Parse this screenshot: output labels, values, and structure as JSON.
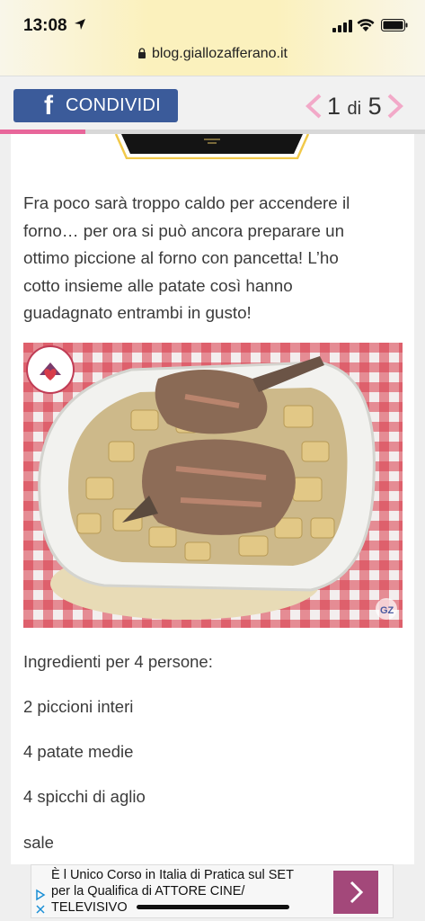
{
  "status_bar": {
    "time": "13:08"
  },
  "url_bar": {
    "domain": "blog.giallozafferano.it"
  },
  "share_bar": {
    "facebook_label": "CONDIVIDI",
    "page_current": "1",
    "page_separator": "di",
    "page_total": "5",
    "progress_fraction": 0.2
  },
  "article": {
    "intro_lines": [
      "Fra poco sarà troppo caldo per accendere il",
      "forno… per ora si può ancora preparare un",
      "ottimo piccione al forno con pancetta! L’ho",
      "cotto insieme alle patate così hanno",
      "guadagnato entrambi in gusto!"
    ],
    "photo_watermark": "GZ",
    "ingredients_title": "Ingredienti per 4 persone:",
    "ingredients": [
      "2 piccioni interi",
      "4 patate medie",
      "4 spicchi di aglio",
      "sale"
    ]
  },
  "ad": {
    "lines": [
      "È l Unico Corso in Italia di Pratica sul SET",
      "per la Qualifica di ATTORE CINE/",
      "TELEVISIVO"
    ],
    "accent_color": "#a3487a"
  },
  "colors": {
    "facebook": "#3b5b9a",
    "progress": "#e8669a",
    "pager_arrows": "#f2a9c8"
  }
}
